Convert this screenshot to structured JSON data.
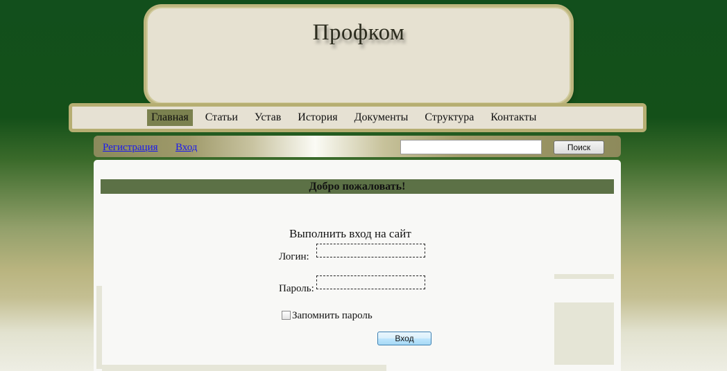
{
  "header": {
    "site_title": "Профком"
  },
  "nav": {
    "items": [
      {
        "label": "Главная",
        "active": true
      },
      {
        "label": "Статьи",
        "active": false
      },
      {
        "label": "Устав",
        "active": false
      },
      {
        "label": "История",
        "active": false
      },
      {
        "label": "Документы",
        "active": false
      },
      {
        "label": "Структура",
        "active": false
      },
      {
        "label": "Контакты",
        "active": false
      }
    ]
  },
  "subbar": {
    "register_link": "Регистрация",
    "login_link": "Вход",
    "search_value": "",
    "search_button": "Поиск"
  },
  "content": {
    "welcome": "Добро пожаловать!",
    "login_title": "Выполнить вход на сайт",
    "login_label": "Логин:",
    "login_value": "",
    "password_label": "Пароль:",
    "password_value": "",
    "remember_label": "Запомнить пароль",
    "remember_checked": false,
    "submit_button": "Вход"
  },
  "colors": {
    "background_top": "#124f1c",
    "nav_active": "#7b814f",
    "welcome_bar": "#5c7146",
    "link": "#1a1aee"
  }
}
